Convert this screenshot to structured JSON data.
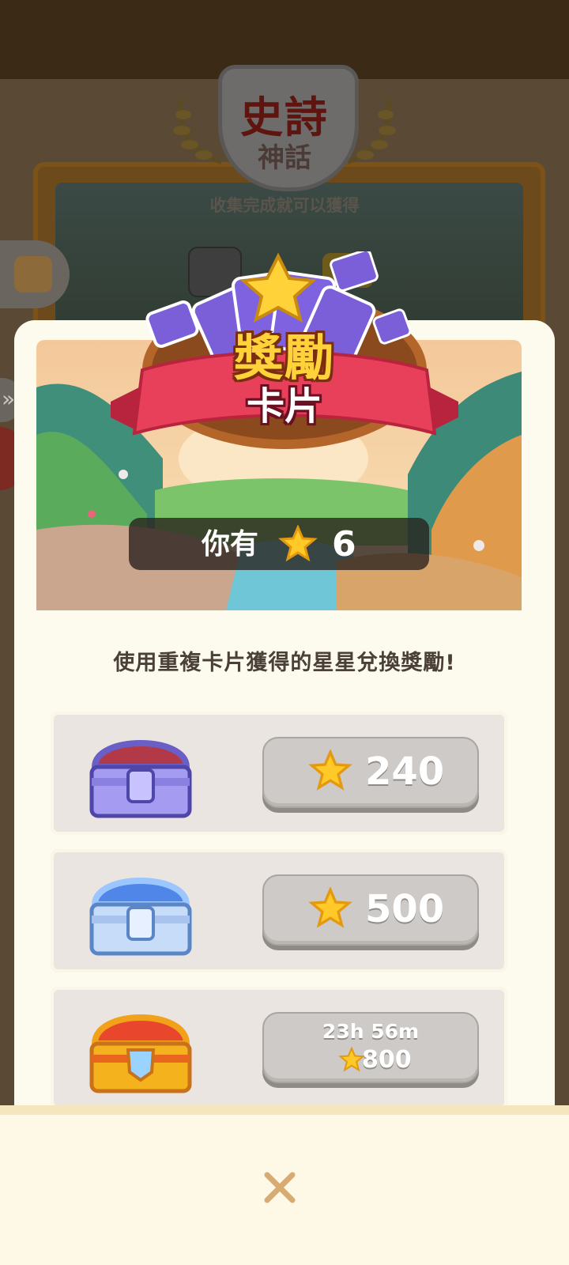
{
  "background": {
    "album_title": "史詩",
    "album_subtitle": "神話",
    "collect_hint": "收集完成就可以獲得"
  },
  "modal": {
    "title": "獎勵",
    "subtitle": "卡片",
    "stars_label": "你有",
    "stars_count": "6",
    "description": "使用重複卡片獲得的星星兌換獎勵!",
    "rewards": [
      {
        "chest": "purple-chest",
        "price": "240",
        "timer": ""
      },
      {
        "chest": "blue-chest",
        "price": "500",
        "timer": ""
      },
      {
        "chest": "gold-chest",
        "price": "800",
        "timer": "23h 56m"
      }
    ]
  },
  "colors": {
    "accent_gold": "#ffd23a",
    "ribbon_red": "#e8405a",
    "button_gray": "#cdcac7",
    "modal_bg": "#fdfaee"
  }
}
